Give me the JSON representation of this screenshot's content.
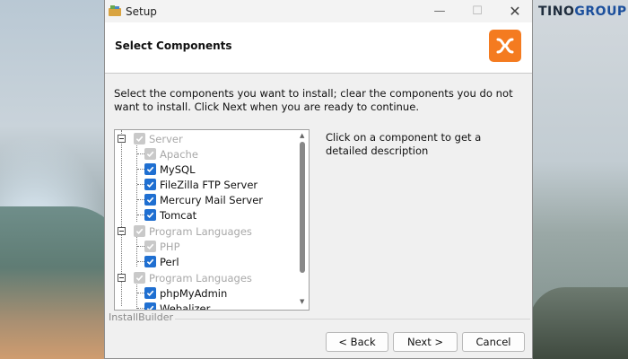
{
  "brand": {
    "prefix": "TINO",
    "suffix": "GROUP"
  },
  "window": {
    "title": "Setup",
    "controls": {
      "minimize": "—",
      "maximize": "☐",
      "close": "✕"
    }
  },
  "header": {
    "title": "Select Components"
  },
  "instructions": "Select the components you want to install; clear the components you do not want to install. Click Next when you are ready to continue.",
  "tree": {
    "items": [
      {
        "label": "Server",
        "checked": true,
        "disabled": true,
        "level": 0,
        "expandable": true
      },
      {
        "label": "Apache",
        "checked": true,
        "disabled": true,
        "level": 1
      },
      {
        "label": "MySQL",
        "checked": true,
        "disabled": false,
        "level": 1
      },
      {
        "label": "FileZilla FTP Server",
        "checked": true,
        "disabled": false,
        "level": 1
      },
      {
        "label": "Mercury Mail Server",
        "checked": true,
        "disabled": false,
        "level": 1
      },
      {
        "label": "Tomcat",
        "checked": true,
        "disabled": false,
        "level": 1
      },
      {
        "label": "Program Languages",
        "checked": true,
        "disabled": true,
        "level": 0,
        "expandable": true
      },
      {
        "label": "PHP",
        "checked": true,
        "disabled": true,
        "level": 1
      },
      {
        "label": "Perl",
        "checked": true,
        "disabled": false,
        "level": 1
      },
      {
        "label": "Program Languages",
        "checked": true,
        "disabled": true,
        "level": 0,
        "expandable": true
      },
      {
        "label": "phpMyAdmin",
        "checked": true,
        "disabled": false,
        "level": 1
      },
      {
        "label": "Webalizer",
        "checked": true,
        "disabled": false,
        "level": 1
      }
    ]
  },
  "description": "Click on a component to get a detailed description",
  "footer": {
    "brand": "InstallBuilder"
  },
  "buttons": {
    "back": "< Back",
    "next": "Next >",
    "cancel": "Cancel"
  },
  "colors": {
    "accent": "#1f6fd1",
    "logo": "#f47b20"
  }
}
